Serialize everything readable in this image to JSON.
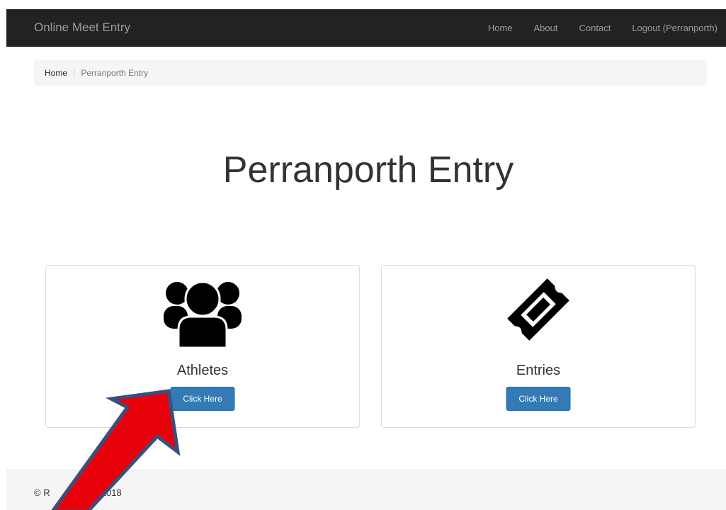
{
  "navbar": {
    "brand": "Online Meet Entry",
    "links": [
      "Home",
      "About",
      "Contact",
      "Logout (Perranporth)"
    ]
  },
  "breadcrumb": {
    "home": "Home",
    "separator": "/",
    "current": "Perranporth Entry"
  },
  "page": {
    "title": "Perranporth Entry"
  },
  "cards": [
    {
      "label": "Athletes",
      "button": "Click Here",
      "icon": "users-icon"
    },
    {
      "label": "Entries",
      "button": "Click Here",
      "icon": "ticket-icon"
    }
  ],
  "footer": {
    "text": "© R                 g 2018"
  },
  "colors": {
    "navbar_bg": "#222222",
    "button_primary": "#337ab7",
    "annotation_arrow": "#e8000b",
    "annotation_arrow_outline": "#3a4f7c"
  }
}
